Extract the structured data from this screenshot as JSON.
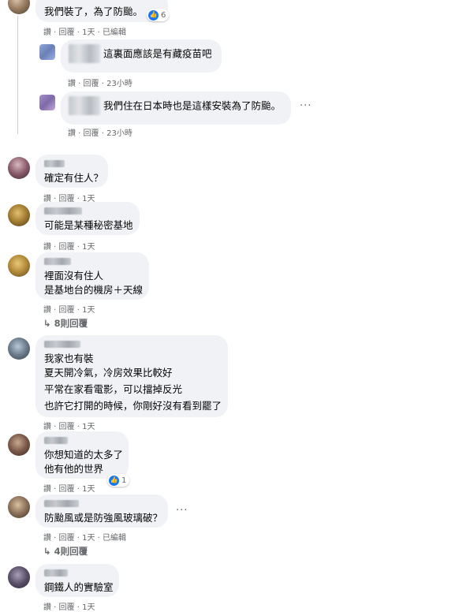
{
  "comments": [
    {
      "text_lines": [
        "我們裝了，為了防颱。"
      ],
      "reaction_count": "6",
      "meta": {
        "like": "讚",
        "reply": "回覆",
        "time": "1天",
        "edited": "已編輯"
      }
    },
    {
      "reply_text": "這裏面應該是有藏疫苗吧",
      "meta": {
        "like": "讚",
        "reply": "回覆",
        "time": "23小時"
      }
    },
    {
      "reply_text": "我們住在日本時也是這樣安裝為了防颱。",
      "meta": {
        "like": "讚",
        "reply": "回覆",
        "time": "23小時"
      }
    },
    {
      "text_lines": [
        "確定有住人？"
      ],
      "meta": {
        "like": "讚",
        "reply": "回覆",
        "time": "1天"
      }
    },
    {
      "text_lines": [
        "可能是某種秘密基地"
      ],
      "meta": {
        "like": "讚",
        "reply": "回覆",
        "time": "1天"
      }
    },
    {
      "text_lines": [
        "裡面沒有住人",
        "是基地台的機房＋天線"
      ],
      "meta": {
        "like": "讚",
        "reply": "回覆",
        "time": "1天"
      },
      "replies_link": "8則回覆"
    },
    {
      "text_lines": [
        "我家也有裝",
        "夏天開冷氣，冷房效果比較好",
        "平常在家看電影，可以擋掉反光",
        "也許它打開的時候，你剛好沒有看到罷了"
      ],
      "meta": {
        "like": "讚",
        "reply": "回覆",
        "time": "1天"
      }
    },
    {
      "text_lines": [
        "你想知道的太多了",
        "他有他的世界"
      ],
      "reaction_count": "1",
      "meta": {
        "like": "讚",
        "reply": "回覆",
        "time": "1天"
      }
    },
    {
      "text_lines": [
        "防颱風或是防強風玻璃破？"
      ],
      "meta": {
        "like": "讚",
        "reply": "回覆",
        "time": "1天",
        "edited": "已編輯"
      },
      "replies_link": "4則回覆"
    },
    {
      "text_lines": [
        "鋼鐵人的實驗室"
      ],
      "meta": {
        "like": "讚",
        "reply": "回覆",
        "time": "1天"
      }
    }
  ],
  "colors": {
    "bubble": "#f0f2f5",
    "meta": "#65676b",
    "like": "#1877f2"
  }
}
